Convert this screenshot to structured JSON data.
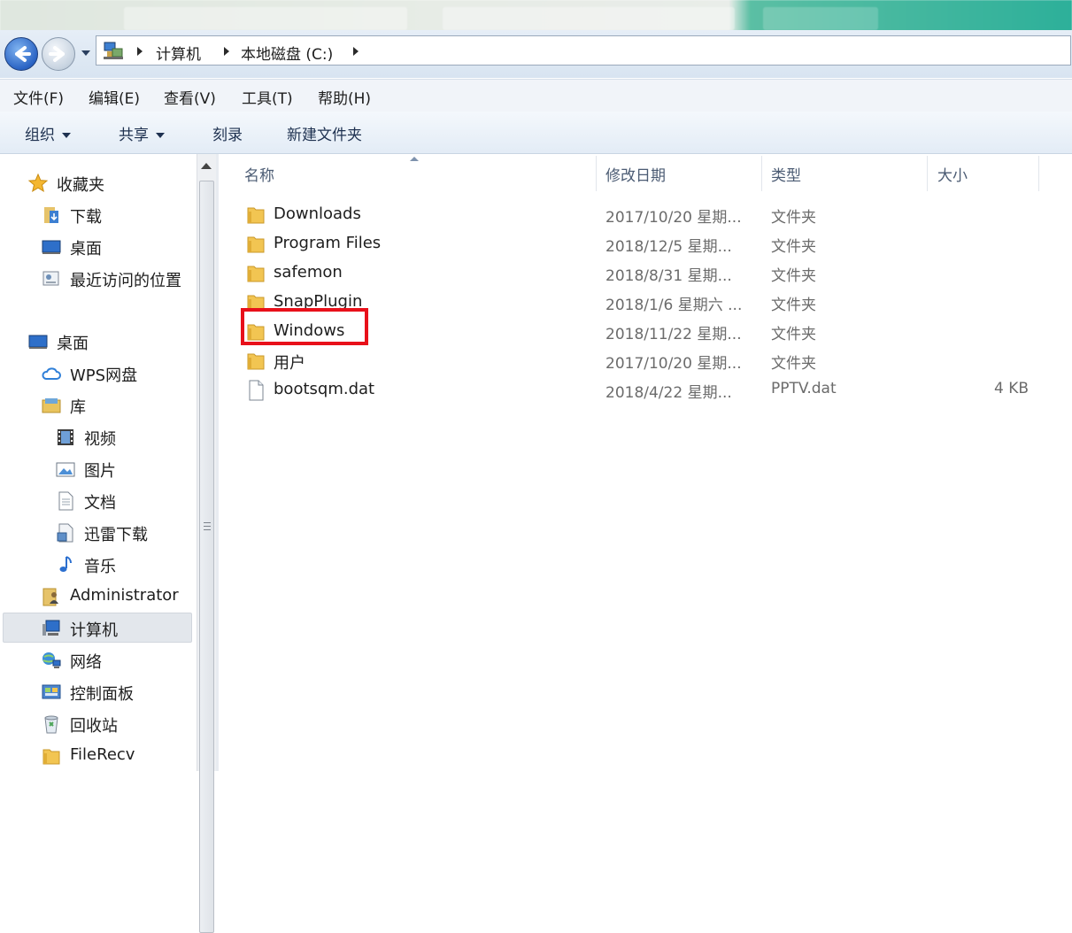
{
  "address": {
    "breadcrumbs": [
      "计算机",
      "本地磁盘 (C:)"
    ]
  },
  "menubar": {
    "items": [
      "文件(F)",
      "编辑(E)",
      "查看(V)",
      "工具(T)",
      "帮助(H)"
    ]
  },
  "toolbar": {
    "organize": "组织",
    "share": "共享",
    "burn": "刻录",
    "new_folder": "新建文件夹"
  },
  "navpane": {
    "favorites": "收藏夹",
    "downloads": "下载",
    "desktop_fav": "桌面",
    "recent": "最近访问的位置",
    "desktop": "桌面",
    "wps": "WPS网盘",
    "libraries": "库",
    "video": "视频",
    "pictures": "图片",
    "documents": "文档",
    "xunlei": "迅雷下载",
    "music": "音乐",
    "admin": "Administrator",
    "computer": "计算机",
    "network": "网络",
    "control_panel": "控制面板",
    "recycle": "回收站",
    "filerecv": "FileRecv"
  },
  "columns": {
    "name": "名称",
    "modified": "修改日期",
    "type": "类型",
    "size": "大小"
  },
  "files": [
    {
      "name": "Downloads",
      "date": "2017/10/20 星期...",
      "type": "文件夹",
      "size": ""
    },
    {
      "name": "Program Files",
      "date": "2018/12/5 星期...",
      "type": "文件夹",
      "size": ""
    },
    {
      "name": "safemon",
      "date": "2018/8/31 星期...",
      "type": "文件夹",
      "size": ""
    },
    {
      "name": "SnapPlugin",
      "date": "2018/1/6 星期六 ...",
      "type": "文件夹",
      "size": ""
    },
    {
      "name": "Windows",
      "date": "2018/11/22 星期...",
      "type": "文件夹",
      "size": ""
    },
    {
      "name": "用户",
      "date": "2017/10/20 星期...",
      "type": "文件夹",
      "size": ""
    },
    {
      "name": "bootsqm.dat",
      "date": "2018/4/22 星期...",
      "type": "PPTV.dat",
      "size": "4 KB"
    }
  ],
  "colors": {
    "highlight_box": "#e8101a",
    "folder": "#f2c552"
  }
}
